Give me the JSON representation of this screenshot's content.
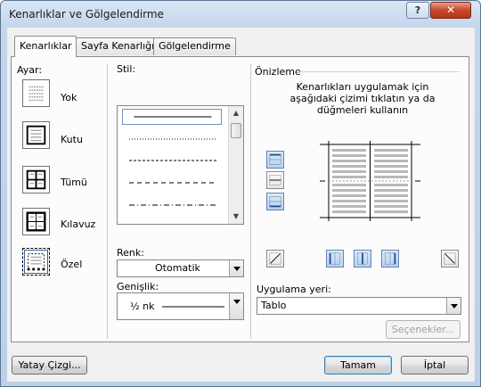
{
  "dialog": {
    "title": "Kenarlıklar ve Gölgelendirme",
    "help_glyph": "?",
    "close_glyph": "✕"
  },
  "tabs": [
    {
      "label": "Kenarlıklar",
      "active": true
    },
    {
      "label": "Sayfa Kenarlığı",
      "active": false
    },
    {
      "label": "Gölgelendirme",
      "active": false
    }
  ],
  "setting": {
    "label": "Ayar:",
    "options": [
      {
        "label": "Yok",
        "icon": "border-none-icon",
        "selected": false
      },
      {
        "label": "Kutu",
        "icon": "border-box-icon",
        "selected": false
      },
      {
        "label": "Tümü",
        "icon": "border-all-icon",
        "selected": false
      },
      {
        "label": "Kılavuz",
        "icon": "border-grid-icon",
        "selected": false
      },
      {
        "label": "Özel",
        "icon": "border-custom-icon",
        "selected": true
      }
    ]
  },
  "style": {
    "label": "Stil:",
    "items": [
      "solid",
      "dotted",
      "dashed-small",
      "dashed",
      "dash-dot"
    ],
    "selected_index": 0
  },
  "color": {
    "label": "Renk:",
    "value": "Otomatik"
  },
  "width": {
    "label": "Genişlik:",
    "value": "½ nk"
  },
  "preview": {
    "label": "Önizleme",
    "instructions": "Kenarlıkları uygulamak için aşağıdaki çizimi tıklatın ya da düğmeleri kullanın"
  },
  "apply_to": {
    "label": "Uygulama yeri:",
    "value": "Tablo"
  },
  "buttons": {
    "options": "Seçenekler...",
    "horizontal_line": "Yatay Çizgi...",
    "ok": "Tamam",
    "cancel": "İptal"
  },
  "colors": {
    "accent": "#3c7fb1",
    "selection_blue": "#6a95c8",
    "title_close": "#c7472c"
  }
}
